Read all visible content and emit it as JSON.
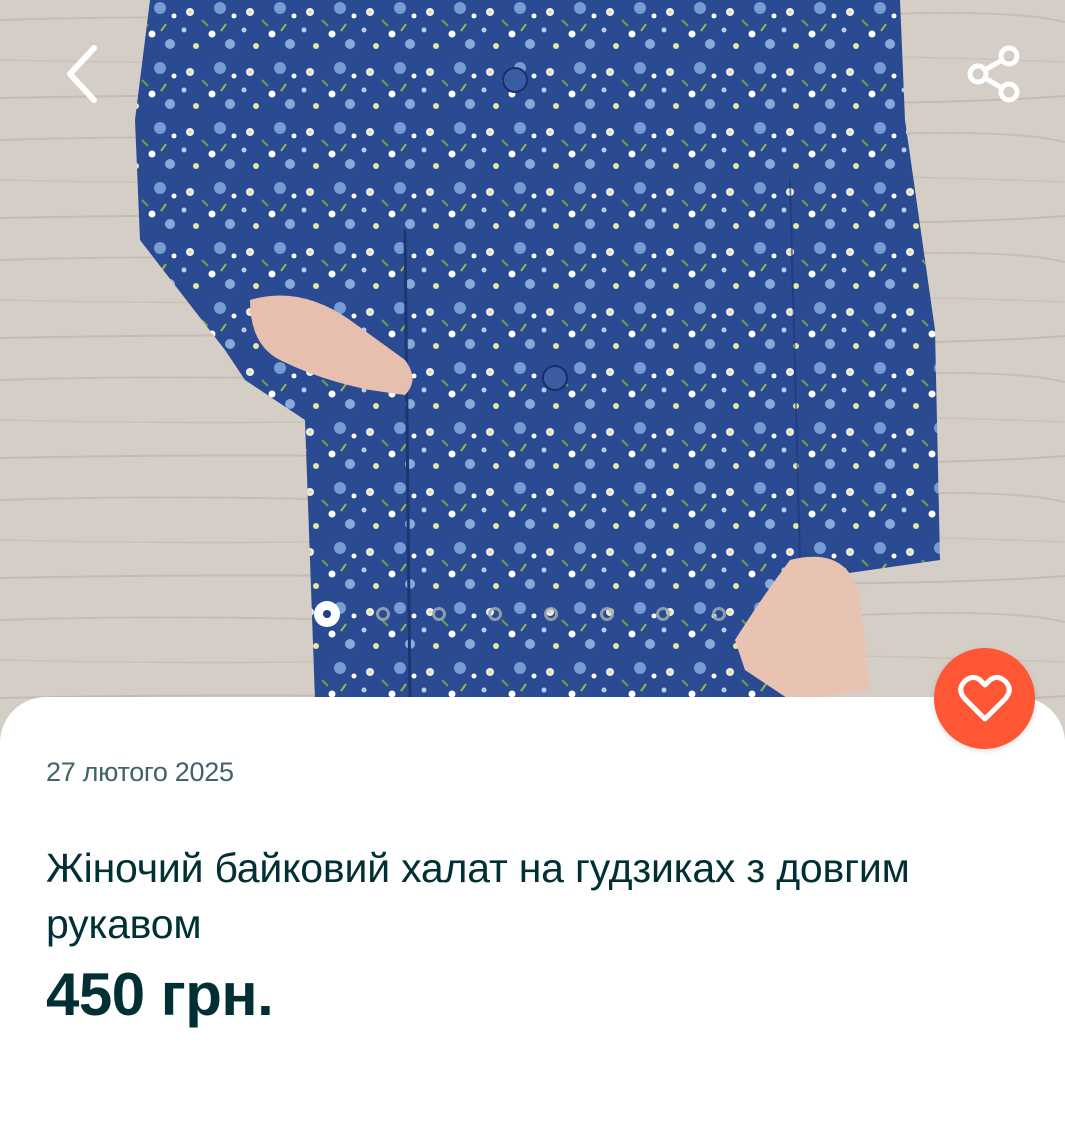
{
  "gallery": {
    "photo_alt": "Жіночий байковий халат",
    "total_images": 8,
    "active_index": 0
  },
  "listing": {
    "date": "27 лютого 2025",
    "title": "Жіночий байковий халат на гудзиках з довгим рукавом",
    "price": "450 грн."
  },
  "icons": {
    "back": "chevron-left-icon",
    "share": "share-icon",
    "favorite": "heart-icon"
  },
  "colors": {
    "accent": "#ff5636",
    "title_text": "#002f34",
    "date_text": "#406367",
    "fabric": "#1f3f86"
  }
}
